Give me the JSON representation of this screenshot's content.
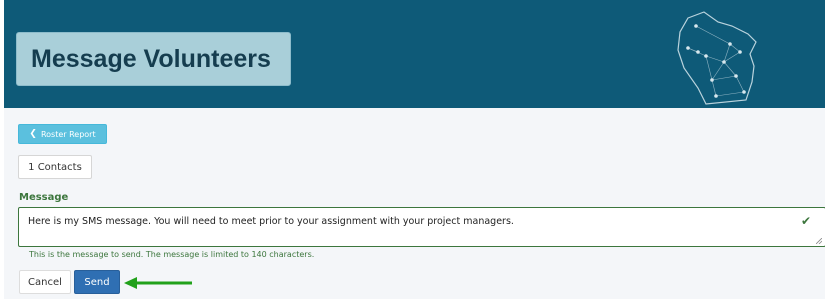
{
  "header": {
    "title": "Message Volunteers",
    "map_icon": "wisconsin-network-map-icon",
    "bg_color": "#0e5a78"
  },
  "toolbar": {
    "roster_report_label": "Roster Report",
    "roster_icon": "chevron-left-icon"
  },
  "contacts": {
    "label": "1 Contacts"
  },
  "message": {
    "label": "Message",
    "value": "Here is my SMS message. You will need to meet prior to your assignment with your project managers.",
    "valid_icon": "checkmark-icon",
    "help_text": "This is the message to send. The message is limited to 140 characters."
  },
  "actions": {
    "cancel_label": "Cancel",
    "send_label": "Send",
    "pointer_icon": "green-arrow-icon"
  },
  "colors": {
    "accent_info": "#5bc0de",
    "primary": "#2f6fb3",
    "success": "#3c763d"
  }
}
